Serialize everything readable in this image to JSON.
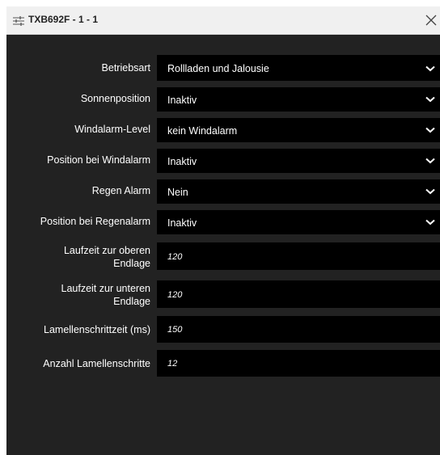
{
  "dialog": {
    "title": "TXB692F - 1 - 1",
    "icons": {
      "settings": "sliders-icon",
      "close": "close-icon"
    }
  },
  "form": {
    "selects": [
      {
        "label": "Betriebsart",
        "value": "Rollladen und Jalousie"
      },
      {
        "label": "Sonnenposition",
        "value": "Inaktiv"
      },
      {
        "label": "Windalarm-Level",
        "value": "kein Windalarm"
      },
      {
        "label": "Position bei Windalarm",
        "value": "Inaktiv"
      },
      {
        "label": "Regen Alarm",
        "value": "Nein"
      },
      {
        "label": "Position bei Regenalarm",
        "value": "Inaktiv"
      }
    ],
    "inputs": [
      {
        "label_line1": "Laufzeit zur oberen",
        "label_line2": "Endlage",
        "value": "120"
      },
      {
        "label_line1": "Laufzeit zur unteren",
        "label_line2": "Endlage",
        "value": "120"
      },
      {
        "label": "Lamellenschrittzeit (ms)",
        "value": "150"
      },
      {
        "label": "Anzahl Lamellenschritte",
        "value": "12"
      }
    ]
  },
  "colors": {
    "background": "#222222",
    "field": "#000000",
    "titlebar": "#f0f0f0",
    "text": "#ffffff"
  }
}
